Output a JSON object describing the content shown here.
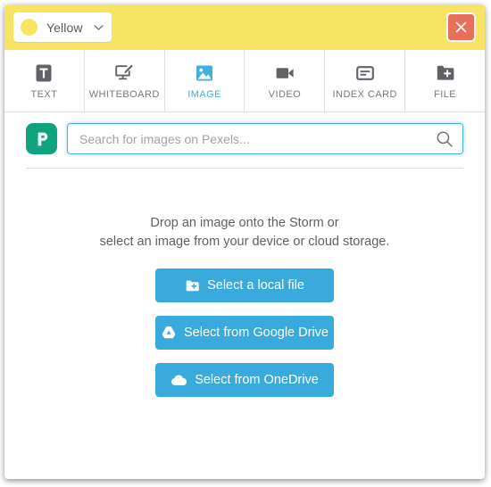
{
  "header": {
    "color_select": {
      "label": "Yellow",
      "swatch_color": "#f7e463",
      "chevron_icon": "chevron-down-icon"
    },
    "background_color": "#f7e463",
    "close_button": {
      "icon": "close-icon",
      "color": "#e8705a"
    }
  },
  "tabs": [
    {
      "label": "TEXT",
      "icon": "text-icon",
      "active": false
    },
    {
      "label": "WHITEBOARD",
      "icon": "whiteboard-icon",
      "active": false
    },
    {
      "label": "IMAGE",
      "icon": "image-icon",
      "active": true
    },
    {
      "label": "VIDEO",
      "icon": "video-icon",
      "active": false
    },
    {
      "label": "INDEX CARD",
      "icon": "index-card-icon",
      "active": false
    },
    {
      "label": "FILE",
      "icon": "file-add-icon",
      "active": false
    }
  ],
  "search": {
    "provider_logo": "pexels-logo",
    "placeholder": "Search for images on Pexels...",
    "value": "",
    "icon": "search-icon"
  },
  "main": {
    "drop_line1": "Drop an image onto the Storm or",
    "drop_line2": "select an image from your device or cloud storage.",
    "buttons": [
      {
        "label": "Select a local file",
        "icon": "folder-add-icon"
      },
      {
        "label": "Select from Google Drive",
        "icon": "google-drive-icon"
      },
      {
        "label": "Select from OneDrive",
        "icon": "cloud-icon"
      }
    ]
  },
  "colors": {
    "accent_blue": "#3aa9dc",
    "tab_active_blue": "#41b0e0",
    "header_yellow": "#f7e463",
    "close_red": "#e8705a",
    "pexels_green": "#10a37f",
    "icon_gray": "#5f6368"
  }
}
